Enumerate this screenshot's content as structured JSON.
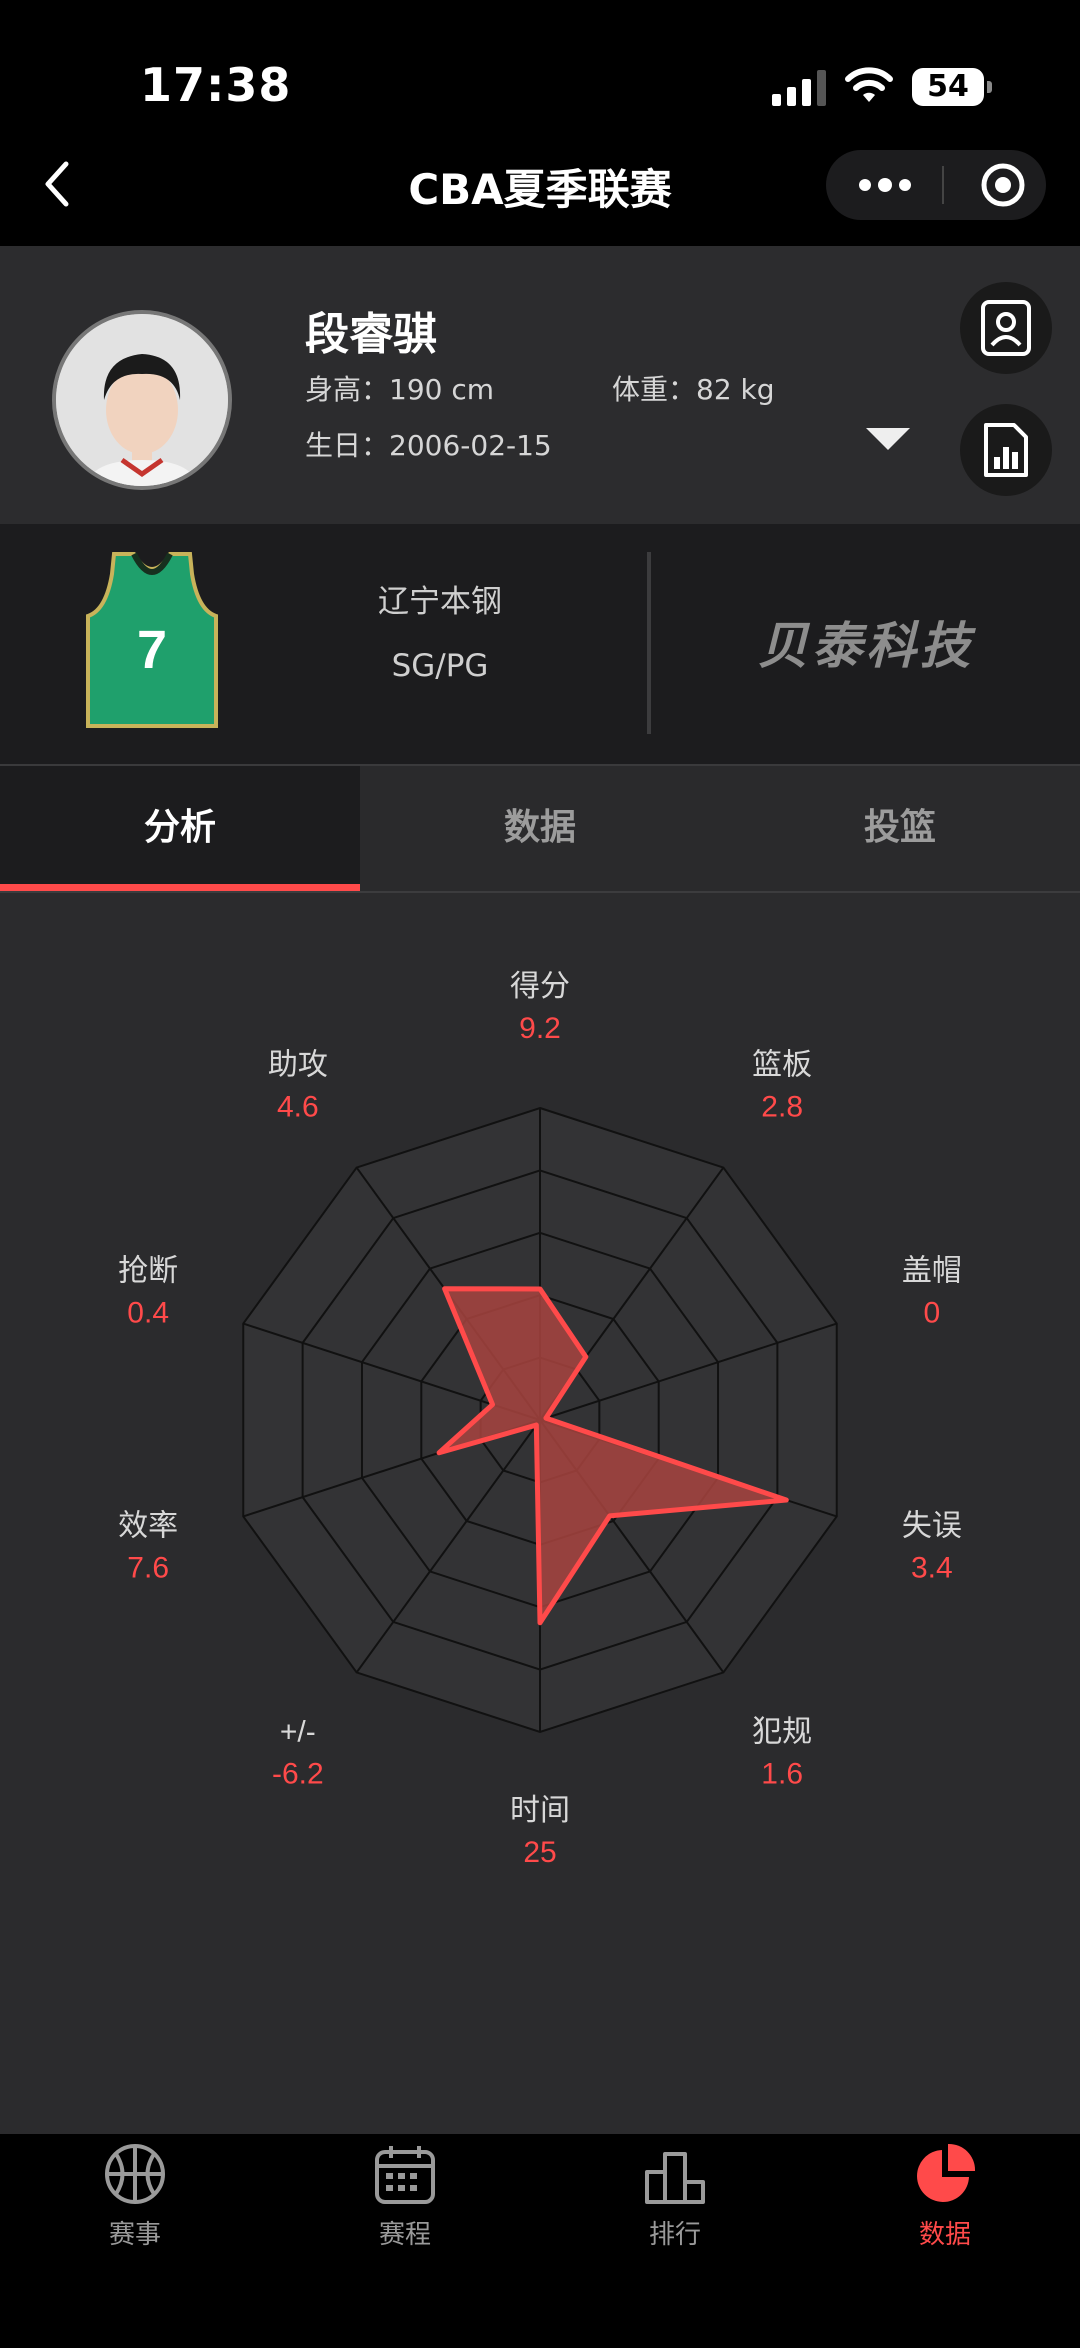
{
  "status": {
    "time": "17:38",
    "battery": "54"
  },
  "nav": {
    "title": "CBA夏季联赛"
  },
  "player": {
    "name": "段睿骐",
    "height_label": "身高：",
    "height_value": "190 cm",
    "weight_label": "体重：",
    "weight_value": "82 kg",
    "birthday_label": "生日：",
    "birthday_value": "2006-02-15",
    "jersey_number": "7",
    "team": "辽宁本钢",
    "position": "SG/PG"
  },
  "sponsor": "贝泰科技",
  "tabs": [
    "分析",
    "数据",
    "投篮"
  ],
  "active_tab": 0,
  "radar": {
    "axes": [
      {
        "label": "得分",
        "value": "9.2",
        "level": 0.42
      },
      {
        "label": "篮板",
        "value": "2.8",
        "level": 0.25
      },
      {
        "label": "盖帽",
        "value": "0",
        "level": 0.02
      },
      {
        "label": "失误",
        "value": "3.4",
        "level": 0.83
      },
      {
        "label": "犯规",
        "value": "1.6",
        "level": 0.38
      },
      {
        "label": "时间",
        "value": "25",
        "level": 0.65
      },
      {
        "label": "+/-",
        "value": "-6.2",
        "level": 0.02
      },
      {
        "label": "效率",
        "value": "7.6",
        "level": 0.34
      },
      {
        "label": "抢断",
        "value": "0.4",
        "level": 0.16
      },
      {
        "label": "助攻",
        "value": "4.6",
        "level": 0.52
      }
    ],
    "colors": {
      "accent": "#ff4a4a",
      "fill": "#a8443f",
      "grid": "#111111",
      "bg": "#333335"
    }
  },
  "bottom_nav": [
    {
      "label": "赛事",
      "icon": "basketball-icon"
    },
    {
      "label": "赛程",
      "icon": "calendar-icon"
    },
    {
      "label": "排行",
      "icon": "ranking-icon"
    },
    {
      "label": "数据",
      "icon": "pie-chart-icon"
    }
  ],
  "active_nav": 3
}
